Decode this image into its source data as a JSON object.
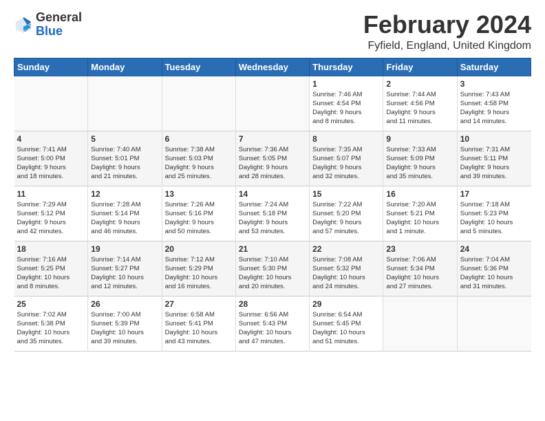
{
  "header": {
    "logo_general": "General",
    "logo_blue": "Blue",
    "month": "February 2024",
    "location": "Fyfield, England, United Kingdom"
  },
  "weekdays": [
    "Sunday",
    "Monday",
    "Tuesday",
    "Wednesday",
    "Thursday",
    "Friday",
    "Saturday"
  ],
  "weeks": [
    [
      {
        "day": "",
        "content": ""
      },
      {
        "day": "",
        "content": ""
      },
      {
        "day": "",
        "content": ""
      },
      {
        "day": "",
        "content": ""
      },
      {
        "day": "1",
        "content": "Sunrise: 7:46 AM\nSunset: 4:54 PM\nDaylight: 9 hours\nand 8 minutes."
      },
      {
        "day": "2",
        "content": "Sunrise: 7:44 AM\nSunset: 4:56 PM\nDaylight: 9 hours\nand 11 minutes."
      },
      {
        "day": "3",
        "content": "Sunrise: 7:43 AM\nSunset: 4:58 PM\nDaylight: 9 hours\nand 14 minutes."
      }
    ],
    [
      {
        "day": "4",
        "content": "Sunrise: 7:41 AM\nSunset: 5:00 PM\nDaylight: 9 hours\nand 18 minutes."
      },
      {
        "day": "5",
        "content": "Sunrise: 7:40 AM\nSunset: 5:01 PM\nDaylight: 9 hours\nand 21 minutes."
      },
      {
        "day": "6",
        "content": "Sunrise: 7:38 AM\nSunset: 5:03 PM\nDaylight: 9 hours\nand 25 minutes."
      },
      {
        "day": "7",
        "content": "Sunrise: 7:36 AM\nSunset: 5:05 PM\nDaylight: 9 hours\nand 28 minutes."
      },
      {
        "day": "8",
        "content": "Sunrise: 7:35 AM\nSunset: 5:07 PM\nDaylight: 9 hours\nand 32 minutes."
      },
      {
        "day": "9",
        "content": "Sunrise: 7:33 AM\nSunset: 5:09 PM\nDaylight: 9 hours\nand 35 minutes."
      },
      {
        "day": "10",
        "content": "Sunrise: 7:31 AM\nSunset: 5:11 PM\nDaylight: 9 hours\nand 39 minutes."
      }
    ],
    [
      {
        "day": "11",
        "content": "Sunrise: 7:29 AM\nSunset: 5:12 PM\nDaylight: 9 hours\nand 42 minutes."
      },
      {
        "day": "12",
        "content": "Sunrise: 7:28 AM\nSunset: 5:14 PM\nDaylight: 9 hours\nand 46 minutes."
      },
      {
        "day": "13",
        "content": "Sunrise: 7:26 AM\nSunset: 5:16 PM\nDaylight: 9 hours\nand 50 minutes."
      },
      {
        "day": "14",
        "content": "Sunrise: 7:24 AM\nSunset: 5:18 PM\nDaylight: 9 hours\nand 53 minutes."
      },
      {
        "day": "15",
        "content": "Sunrise: 7:22 AM\nSunset: 5:20 PM\nDaylight: 9 hours\nand 57 minutes."
      },
      {
        "day": "16",
        "content": "Sunrise: 7:20 AM\nSunset: 5:21 PM\nDaylight: 10 hours\nand 1 minute."
      },
      {
        "day": "17",
        "content": "Sunrise: 7:18 AM\nSunset: 5:23 PM\nDaylight: 10 hours\nand 5 minutes."
      }
    ],
    [
      {
        "day": "18",
        "content": "Sunrise: 7:16 AM\nSunset: 5:25 PM\nDaylight: 10 hours\nand 8 minutes."
      },
      {
        "day": "19",
        "content": "Sunrise: 7:14 AM\nSunset: 5:27 PM\nDaylight: 10 hours\nand 12 minutes."
      },
      {
        "day": "20",
        "content": "Sunrise: 7:12 AM\nSunset: 5:29 PM\nDaylight: 10 hours\nand 16 minutes."
      },
      {
        "day": "21",
        "content": "Sunrise: 7:10 AM\nSunset: 5:30 PM\nDaylight: 10 hours\nand 20 minutes."
      },
      {
        "day": "22",
        "content": "Sunrise: 7:08 AM\nSunset: 5:32 PM\nDaylight: 10 hours\nand 24 minutes."
      },
      {
        "day": "23",
        "content": "Sunrise: 7:06 AM\nSunset: 5:34 PM\nDaylight: 10 hours\nand 27 minutes."
      },
      {
        "day": "24",
        "content": "Sunrise: 7:04 AM\nSunset: 5:36 PM\nDaylight: 10 hours\nand 31 minutes."
      }
    ],
    [
      {
        "day": "25",
        "content": "Sunrise: 7:02 AM\nSunset: 5:38 PM\nDaylight: 10 hours\nand 35 minutes."
      },
      {
        "day": "26",
        "content": "Sunrise: 7:00 AM\nSunset: 5:39 PM\nDaylight: 10 hours\nand 39 minutes."
      },
      {
        "day": "27",
        "content": "Sunrise: 6:58 AM\nSunset: 5:41 PM\nDaylight: 10 hours\nand 43 minutes."
      },
      {
        "day": "28",
        "content": "Sunrise: 6:56 AM\nSunset: 5:43 PM\nDaylight: 10 hours\nand 47 minutes."
      },
      {
        "day": "29",
        "content": "Sunrise: 6:54 AM\nSunset: 5:45 PM\nDaylight: 10 hours\nand 51 minutes."
      },
      {
        "day": "",
        "content": ""
      },
      {
        "day": "",
        "content": ""
      }
    ]
  ]
}
